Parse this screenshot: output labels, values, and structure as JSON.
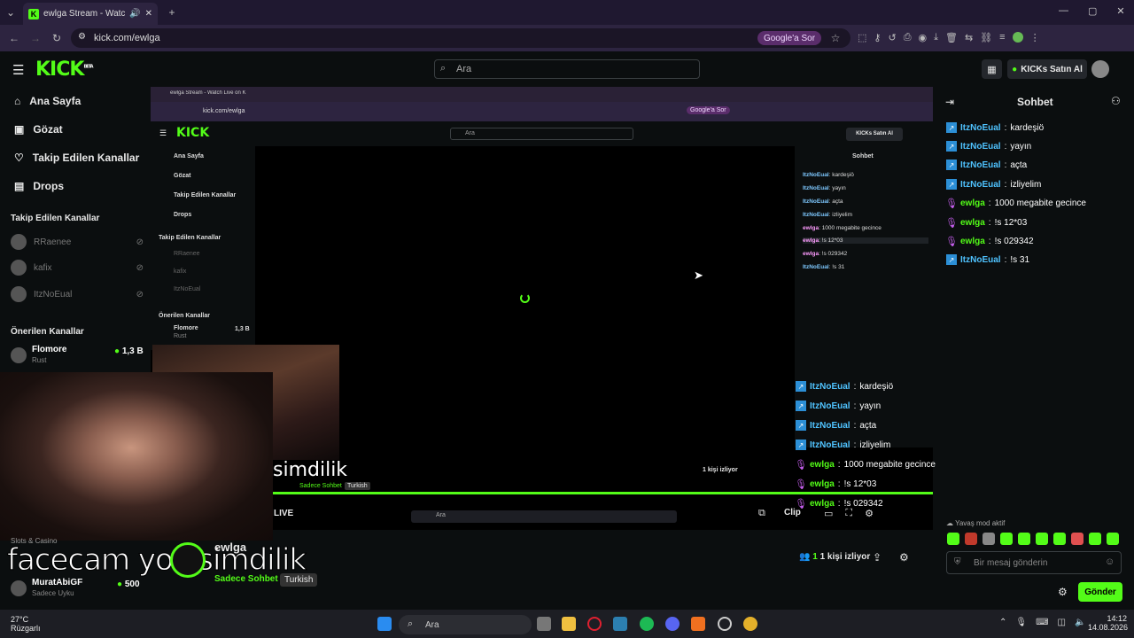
{
  "browser": {
    "tab_title": "ewlga Stream - Watch Live o",
    "url": "kick.com/ewlga",
    "google_sor": "Google'a Sor"
  },
  "header": {
    "logo": "KICK",
    "logo_beta": "BETA",
    "search_placeholder": "Ara",
    "buy_kicks": "KICKs Satın Al"
  },
  "sidebar": {
    "nav": [
      {
        "label": "Ana Sayfa",
        "icon": "home-icon"
      },
      {
        "label": "Gözat",
        "icon": "browse-icon"
      },
      {
        "label": "Takip Edilen Kanallar",
        "icon": "heart-icon"
      },
      {
        "label": "Drops",
        "icon": "drops-icon"
      }
    ],
    "followed_heading": "Takip Edilen Kanallar",
    "followed": [
      "RRaenee",
      "kafix",
      "ItzNoEual"
    ],
    "recommended_heading": "Önerilen Kanallar",
    "recommended": [
      {
        "name": "Flomore",
        "category": "Rust",
        "viewers": "1,3 B"
      }
    ],
    "bottom_channel": {
      "name": "MuratAbiGF",
      "category": "Sadece Uyku",
      "viewers": "500"
    },
    "slots_label": "Slots & Casino"
  },
  "inner": {
    "tab_title": "ewlga Stream - Watch Live on K",
    "url": "kick.com/ewlga",
    "google_sor": "Google'a Sor",
    "search": "Ara",
    "buy_kicks": "KICKs Satın Al",
    "nav": [
      "Ana Sayfa",
      "Gözat",
      "Takip Edilen Kanallar",
      "Drops"
    ],
    "followed_heading": "Takip Edilen Kanallar",
    "followed": [
      "RRaenee",
      "kafix",
      "ItzNoEual"
    ],
    "recommended_heading": "Önerilen Kanallar",
    "recommended": {
      "name": "Flomore",
      "category": "Rust",
      "viewers": "1,3 B"
    },
    "chat_title": "Sohbet",
    "chat": [
      {
        "user": "ItzNoEual",
        "msg": "kardeşiö"
      },
      {
        "user": "ItzNoEual",
        "msg": "yayın"
      },
      {
        "user": "ItzNoEual",
        "msg": "açta"
      },
      {
        "user": "ItzNoEual",
        "msg": "izliyelim"
      },
      {
        "user": "ewlga",
        "msg": "1000 megabite gecince"
      },
      {
        "user": "ewlga",
        "msg": "!s 12*03"
      },
      {
        "user": "ewlga",
        "msg": "!s 029342"
      },
      {
        "user": "ItzNoEual",
        "msg": "!s 31"
      }
    ],
    "viewer_count": "1 kişi izliyor",
    "channel_name": "ewlga",
    "tag1": "Sadece Sohbet",
    "tag2": "Turkish",
    "live": "LIVE",
    "clip": "Clip",
    "send": "Gönder",
    "msg_placeholder": "Bir mesaj gönderin",
    "taskbar_search": "Ara"
  },
  "stream": {
    "overlay_text": "facecam yok simdilik",
    "overlay_small": "simdilik",
    "channel_name": "ewlga",
    "tags": [
      "Sadece Sohbet",
      "Turkish"
    ],
    "viewers": "1 kişi izliyor",
    "live": "LIVE",
    "clip": "Clip"
  },
  "overlay_chat": [
    {
      "user": "ItzNoEual",
      "msg": "kardeşiö",
      "type": "b"
    },
    {
      "user": "ItzNoEual",
      "msg": "yayın",
      "type": "b"
    },
    {
      "user": "ItzNoEual",
      "msg": "açta",
      "type": "b"
    },
    {
      "user": "ItzNoEual",
      "msg": "izliyelim",
      "type": "b"
    },
    {
      "user": "ewlga",
      "msg": "1000 megabite gecince",
      "type": "g"
    },
    {
      "user": "ewlga",
      "msg": "!s 12*03",
      "type": "g"
    },
    {
      "user": "ewlga",
      "msg": "!s 029342",
      "type": "g"
    }
  ],
  "chat": {
    "title": "Sohbet",
    "messages": [
      {
        "user": "ItzNoEual",
        "msg": "kardeşiö",
        "type": "b"
      },
      {
        "user": "ItzNoEual",
        "msg": "yayın",
        "type": "b"
      },
      {
        "user": "ItzNoEual",
        "msg": "açta",
        "type": "b"
      },
      {
        "user": "ItzNoEual",
        "msg": "izliyelim",
        "type": "b"
      },
      {
        "user": "ewlga",
        "msg": "1000 megabite gecince",
        "type": "g"
      },
      {
        "user": "ewlga",
        "msg": "!s 12*03",
        "type": "g"
      },
      {
        "user": "ewlga",
        "msg": "!s 029342",
        "type": "g"
      },
      {
        "user": "ItzNoEual",
        "msg": "!s 31",
        "type": "b"
      }
    ],
    "slow_mode": "Yavaş mod aktif",
    "placeholder": "Bir mesaj gönderin",
    "send": "Gönder"
  },
  "taskbar": {
    "weather_temp": "27°C",
    "weather_desc": "Rüzgarlı",
    "search": "Ara",
    "time": "14:12",
    "date": "14.08.2026"
  },
  "colors": {
    "accent": "#53fc18",
    "bot": "#4fc3ff",
    "mod": "#c85ff0"
  }
}
